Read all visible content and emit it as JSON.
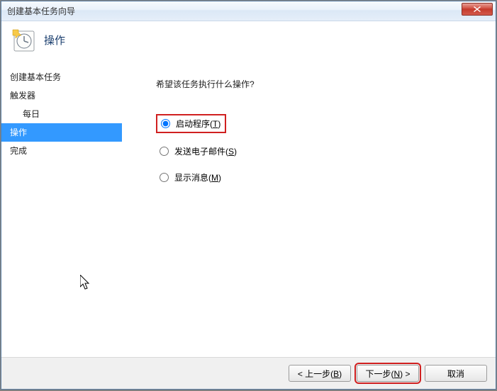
{
  "window": {
    "title": "创建基本任务向导"
  },
  "header": {
    "title": "操作"
  },
  "sidebar": {
    "items": [
      {
        "label": "创建基本任务"
      },
      {
        "label": "触发器"
      },
      {
        "label": "每日"
      },
      {
        "label": "操作"
      },
      {
        "label": "完成"
      }
    ]
  },
  "main": {
    "prompt": "希望该任务执行什么操作?",
    "options": [
      {
        "label": "启动程序",
        "shortcut": "T",
        "checked": true
      },
      {
        "label": "发送电子邮件",
        "shortcut": "S",
        "checked": false
      },
      {
        "label": "显示消息",
        "shortcut": "M",
        "checked": false
      }
    ]
  },
  "footer": {
    "back": "< 上一步(B)",
    "next": "下一步(N) >",
    "cancel": "取消"
  }
}
